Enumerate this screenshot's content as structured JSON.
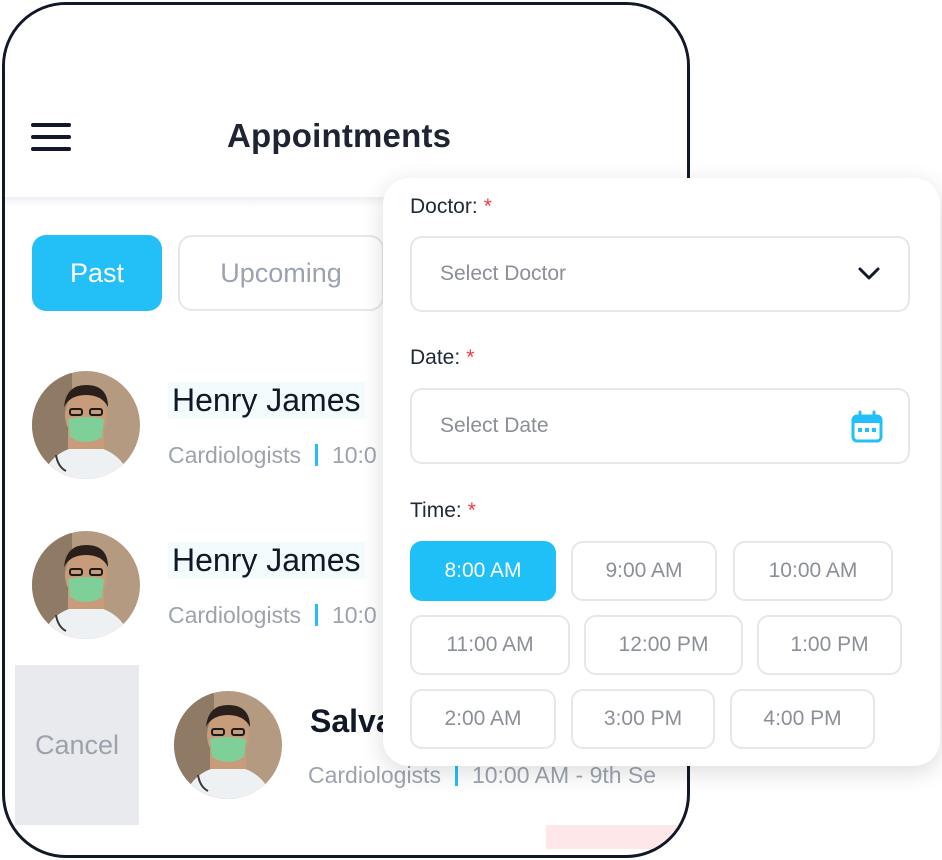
{
  "header": {
    "title": "Appointments"
  },
  "tabs": [
    {
      "label": "Past",
      "active": true
    },
    {
      "label": "Upcoming",
      "active": false
    }
  ],
  "appointments": [
    {
      "name": "Henry James",
      "specialty": "Cardiologists",
      "time": "10:0"
    },
    {
      "name": "Henry James",
      "specialty": "Cardiologists",
      "time": "10:0"
    },
    {
      "name": "Salva",
      "specialty": "Cardiologists",
      "time": "10:00 AM - 9th Se"
    }
  ],
  "swipe_action": {
    "cancel_label": "Cancel"
  },
  "form": {
    "doctor_label": "Doctor:",
    "doctor_placeholder": "Select Doctor",
    "date_label": "Date:",
    "date_placeholder": "Select Date",
    "time_label": "Time:",
    "required_mark": "*",
    "time_slots": [
      "8:00 AM",
      "9:00 AM",
      "10:00 AM",
      "11:00 AM",
      "12:00 PM",
      "1:00 PM",
      "2:00 AM",
      "3:00 PM",
      "4:00 PM"
    ],
    "selected_slot": "8:00 AM"
  },
  "icons": {
    "menu": "hamburger-icon",
    "dropdown": "chevron-down-icon",
    "calendar": "calendar-icon"
  },
  "colors": {
    "accent": "#22c0f6",
    "required": "#ef3b3b",
    "text_dark": "#1f2433",
    "muted": "#9ca3af"
  }
}
